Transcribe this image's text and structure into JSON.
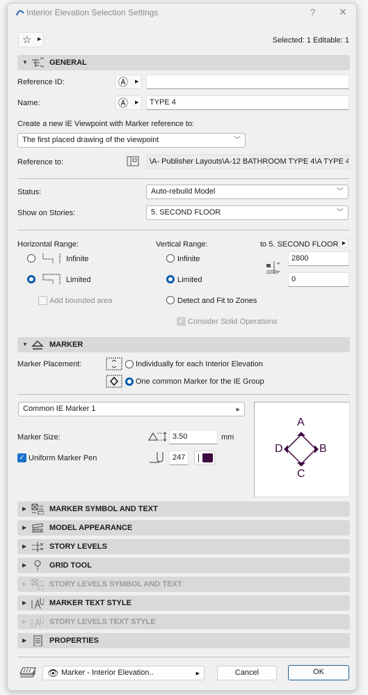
{
  "window": {
    "title": "Interior Elevation Selection Settings",
    "help": "?",
    "close": "✕"
  },
  "selection_info": "Selected: 1 Editable: 1",
  "general": {
    "header": "GENERAL",
    "reference_id_label": "Reference ID:",
    "reference_id_value": "",
    "name_label": "Name:",
    "name_value": "TYPE 4",
    "create_label": "Create a new IE Viewpoint with Marker reference to:",
    "create_value": "The first placed drawing of the viewpoint",
    "reference_to_label": "Reference to:",
    "reference_to_value": "\\A- Publisher Layouts\\A-12 BATHROOM TYPE 4\\A TYPE 4",
    "status_label": "Status:",
    "status_value": "Auto-rebuild Model",
    "stories_label": "Show on Stories:",
    "stories_value": "5. SECOND FLOOR",
    "horizontal_label": "Horizontal Range:",
    "h_infinite": "Infinite",
    "h_limited": "Limited",
    "h_selected": "Limited",
    "add_bounded": "Add bounded area",
    "vertical_label": "Vertical Range:",
    "v_infinite": "Infinite",
    "v_limited": "Limited",
    "v_detect": "Detect and Fit to Zones",
    "v_selected": "Limited",
    "to_story": "to 5. SECOND FLOOR",
    "top_value": "2800",
    "bottom_value": "0",
    "consider_solid": "Consider Solid Operations"
  },
  "marker": {
    "header": "MARKER",
    "placement_label": "Marker Placement:",
    "opt_individual": "Individually for each Interior Elevation",
    "opt_common": "One common Marker for the IE Group",
    "selected": "One common Marker for the IE Group",
    "marker_type": "Common IE Marker 1",
    "size_label": "Marker Size:",
    "size_value": "3.50",
    "size_unit": "mm",
    "uniform_pen_label": "Uniform Marker Pen",
    "uniform_pen_checked": true,
    "pen_value": "247",
    "pen_color": "#3d0a3f",
    "preview_labels": {
      "a": "A",
      "b": "B",
      "c": "C",
      "d": "D"
    }
  },
  "panels": [
    {
      "label": "MARKER SYMBOL AND TEXT",
      "enabled": true,
      "icon": "marker-symbol-icon"
    },
    {
      "label": "MODEL APPEARANCE",
      "enabled": true,
      "icon": "model-appearance-icon"
    },
    {
      "label": "STORY LEVELS",
      "enabled": true,
      "icon": "story-levels-icon"
    },
    {
      "label": "GRID TOOL",
      "enabled": true,
      "icon": "grid-tool-icon"
    },
    {
      "label": "STORY LEVELS SYMBOL AND TEXT",
      "enabled": false,
      "icon": "story-symbol-icon"
    },
    {
      "label": "MARKER TEXT STYLE",
      "enabled": true,
      "icon": "text-style-icon"
    },
    {
      "label": "STORY LEVELS TEXT STYLE",
      "enabled": false,
      "icon": "text-style-icon"
    },
    {
      "label": "PROPERTIES",
      "enabled": true,
      "icon": "properties-icon"
    }
  ],
  "footer": {
    "layer_value": "Marker - Interior Elevation..",
    "cancel": "Cancel",
    "ok": "OK"
  }
}
